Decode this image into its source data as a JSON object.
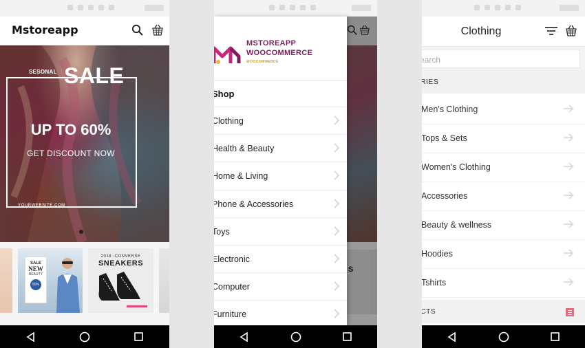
{
  "phone1": {
    "app_title": "Mstoreapp",
    "hero": {
      "seasonal": "SESONAL",
      "sale": "SALE",
      "headline": "UP TO 60%",
      "cta": "GET DISCOUNT NOW",
      "website": "YOURWEBSITE.COM"
    },
    "thumb_new": {
      "line1": "SALE",
      "line2": "NEW",
      "line3": "BEAUTY",
      "badge": "50%"
    },
    "thumb_sneakers": {
      "year": "2018 -CONVERSE",
      "title": "SNEAKERS"
    }
  },
  "phone2": {
    "logo": {
      "line1": "MSTOREAPP",
      "line2": "WOOCOMMERCE",
      "line3": "WOOCOMMERCE"
    },
    "section": "Shop",
    "items": [
      {
        "label": "Clothing"
      },
      {
        "label": "Health & Beauty"
      },
      {
        "label": "Home & Living"
      },
      {
        "label": "Phone & Accessories"
      },
      {
        "label": "Toys"
      },
      {
        "label": "Electronic"
      },
      {
        "label": "Computer"
      },
      {
        "label": "Furniture"
      }
    ],
    "under_text": "S"
  },
  "phone3": {
    "title": "Clothing",
    "search_placeholder": "earch",
    "categories_header": "RIES",
    "categories": [
      {
        "label": "Men's Clothing"
      },
      {
        "label": "Tops & Sets"
      },
      {
        "label": "Women's Clothing"
      },
      {
        "label": "Accessories"
      },
      {
        "label": "Beauty & wellness"
      },
      {
        "label": "Hoodies"
      },
      {
        "label": "Tshirts"
      }
    ],
    "products_header": "CTS"
  },
  "colors": {
    "brand_purple": "#7b1f5c",
    "brand_gold": "#c9a227",
    "accent_pink": "#e0467a",
    "navbar": "#000000"
  },
  "icons": [
    "search-icon",
    "cart-icon",
    "filter-icon",
    "chevron-right-icon",
    "arrow-right-icon",
    "back-nav-icon",
    "home-nav-icon",
    "recents-nav-icon"
  ]
}
